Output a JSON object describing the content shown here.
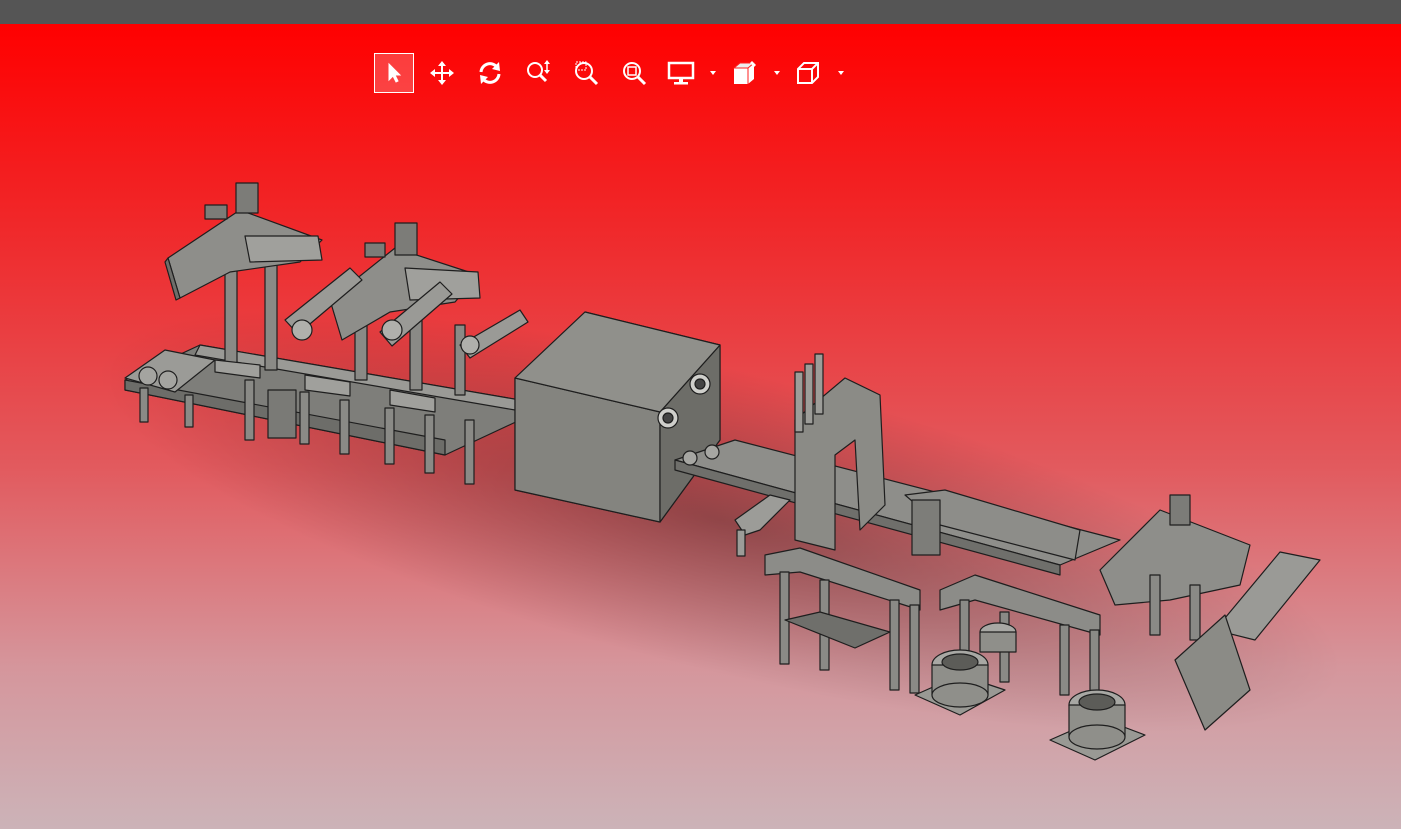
{
  "app": {
    "title": ""
  },
  "toolbar": {
    "tools": [
      {
        "id": "select",
        "icon": "cursor-arrow-icon",
        "active": true
      },
      {
        "id": "pan",
        "icon": "move-arrows-icon",
        "active": false
      },
      {
        "id": "rotate",
        "icon": "rotate-icon",
        "active": false
      },
      {
        "id": "zoom",
        "icon": "zoom-updown-icon",
        "active": false
      },
      {
        "id": "zoom-window",
        "icon": "zoom-window-icon",
        "active": false
      },
      {
        "id": "zoom-fit",
        "icon": "zoom-fit-icon",
        "active": false
      },
      {
        "id": "display",
        "icon": "monitor-icon",
        "active": false,
        "dropdown": true
      },
      {
        "id": "section",
        "icon": "section-view-icon",
        "active": false,
        "dropdown": true
      },
      {
        "id": "view-orientation",
        "icon": "cube-view-icon",
        "active": false,
        "dropdown": true
      }
    ]
  },
  "colors": {
    "background_top": "#ff0000",
    "background_bottom": "#ccb3b8",
    "titlebar": "#555555",
    "model_fill": "#8a8a86",
    "model_edge": "#1e1e1e"
  }
}
